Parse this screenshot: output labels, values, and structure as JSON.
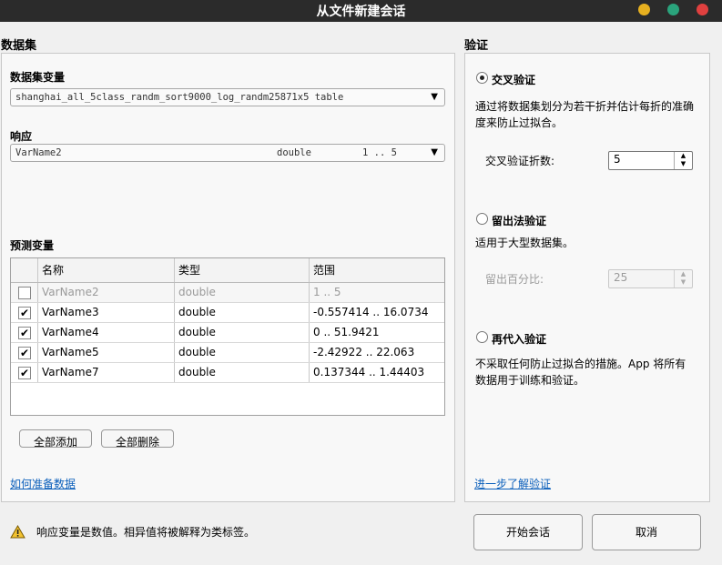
{
  "window": {
    "title": "从文件新建会话"
  },
  "dataset": {
    "section_title": "数据集",
    "dataset_var_label": "数据集变量",
    "dataset_var_value": "shanghai_all_5class_randm_sort9000_log_randm25871x5 table",
    "response_label": "响应",
    "response": {
      "name": "VarName2",
      "type": "double",
      "range": "1 .. 5"
    },
    "predictors_label": "预测变量",
    "table_headers": [
      "名称",
      "类型",
      "范围"
    ],
    "predictors": [
      {
        "checked": false,
        "name": "VarName2",
        "type": "double",
        "range": "1 .. 5",
        "disabled": true
      },
      {
        "checked": true,
        "name": "VarName3",
        "type": "double",
        "range": "-0.557414 .. 16.0734",
        "disabled": false
      },
      {
        "checked": true,
        "name": "VarName4",
        "type": "double",
        "range": "0 .. 51.9421",
        "disabled": false
      },
      {
        "checked": true,
        "name": "VarName5",
        "type": "double",
        "range": "-2.42922 .. 22.063",
        "disabled": false
      },
      {
        "checked": true,
        "name": "VarName7",
        "type": "double",
        "range": "0.137344 .. 1.44403",
        "disabled": false
      }
    ],
    "add_all_label": "全部添加",
    "remove_all_label": "全部删除",
    "help_link": "如何准备数据"
  },
  "validation": {
    "section_title": "验证",
    "cross": {
      "label": "交叉验证",
      "description": "通过将数据集划分为若干折并估计每折的准确度来防止过拟合。",
      "folds_label": "交叉验证折数:",
      "folds_value": "5"
    },
    "holdout": {
      "label": "留出法验证",
      "description": "适用于大型数据集。",
      "percent_label": "留出百分比:",
      "percent_value": "25"
    },
    "resub": {
      "label": "再代入验证",
      "description": "不采取任何防止过拟合的措施。App 将所有数据用于训练和验证。"
    },
    "learn_more_link": "进一步了解验证"
  },
  "footer": {
    "warning": "响应变量是数值。相异值将被解释为类标签。",
    "start_button": "开始会话",
    "cancel_button": "取消"
  },
  "colors": {
    "close": "#e0403f",
    "minimize": "#e6b020",
    "maximize": "#2aa37c",
    "link": "#0b5fbb"
  }
}
